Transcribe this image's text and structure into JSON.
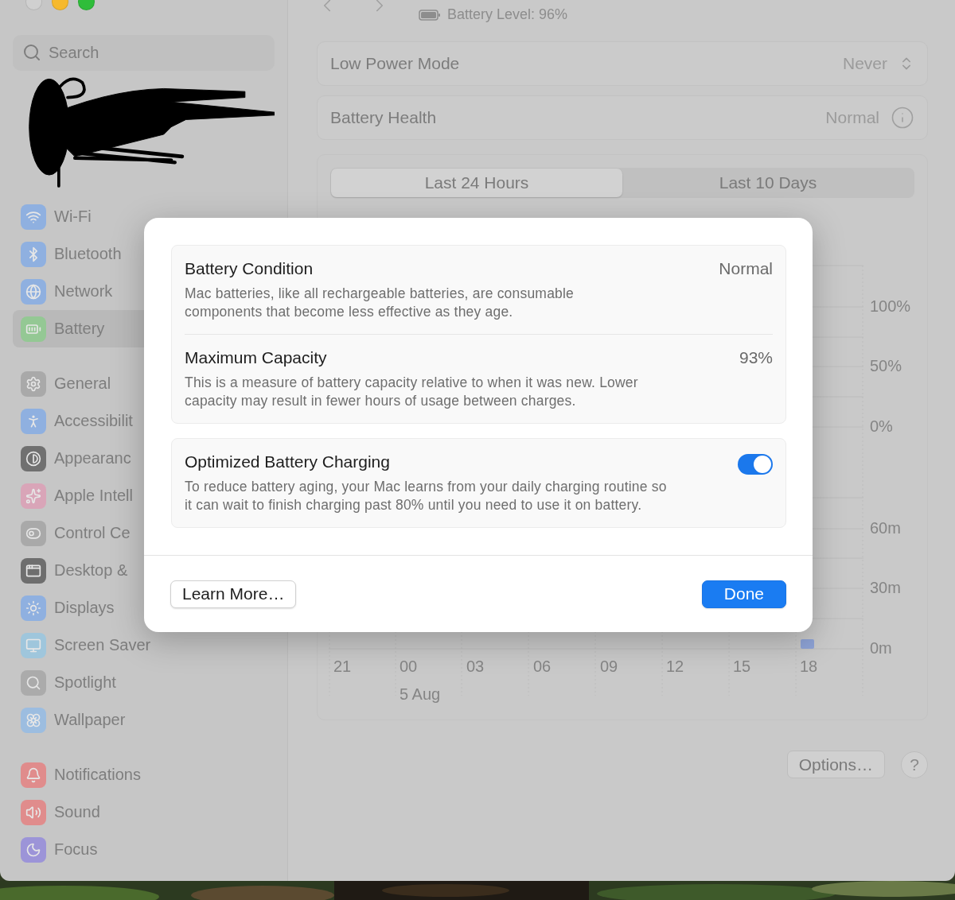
{
  "sidebar": {
    "search": {
      "placeholder": "Search"
    },
    "groups": [
      {
        "items": [
          {
            "label": "Wi-Fi",
            "selected": false,
            "color": "#8fb0e0"
          },
          {
            "label": "Bluetooth",
            "selected": false,
            "color": "#8fb0e0"
          },
          {
            "label": "Network",
            "selected": false,
            "color": "#8fb0e0"
          },
          {
            "label": "Battery",
            "selected": true,
            "color": "#94c894"
          }
        ]
      },
      {
        "items": [
          {
            "label": "General",
            "selected": false,
            "color": "#a9a9a9"
          },
          {
            "label": "Accessibilit",
            "selected": false,
            "color": "#8fb0e0"
          },
          {
            "label": "Appearanc",
            "selected": false,
            "color": "#707070"
          },
          {
            "label": "Apple Intell",
            "selected": false,
            "color": "#d9a5b8"
          },
          {
            "label": "Control Ce",
            "selected": false,
            "color": "#a9a9a9"
          },
          {
            "label": "Desktop &",
            "selected": false,
            "color": "#6e6e6e"
          },
          {
            "label": "Displays",
            "selected": false,
            "color": "#8fb0e0"
          },
          {
            "label": "Screen Saver",
            "selected": false,
            "color": "#9fc6dc"
          },
          {
            "label": "Spotlight",
            "selected": false,
            "color": "#ababab"
          },
          {
            "label": "Wallpaper",
            "selected": false,
            "color": "#9cbde0"
          }
        ]
      },
      {
        "items": [
          {
            "label": "Notifications",
            "selected": false,
            "color": "#e08c8c"
          },
          {
            "label": "Sound",
            "selected": false,
            "color": "#e08c8c"
          },
          {
            "label": "Focus",
            "selected": false,
            "color": "#9c94d8"
          }
        ]
      }
    ]
  },
  "header": {
    "subtitle": "Battery Level: 96%"
  },
  "settings_rows": [
    {
      "kind": "popup",
      "label": "Low Power Mode",
      "value": "Never"
    },
    {
      "kind": "info",
      "label": "Battery Health",
      "value": "Normal"
    }
  ],
  "usage": {
    "tabs": [
      {
        "label": "Last 24 Hours",
        "selected": true
      },
      {
        "label": "Last 10 Days",
        "selected": false
      }
    ],
    "level_ticks": [
      "100%",
      "50%",
      "0%"
    ],
    "time_ticks": [
      "60m",
      "30m",
      "0m"
    ],
    "hours": [
      "21",
      "00",
      "03",
      "06",
      "09",
      "12",
      "15",
      "18"
    ],
    "date": "5 Aug"
  },
  "footer": {
    "options_button": "Options…",
    "help_button": "?"
  },
  "dialog": {
    "groups": [
      {
        "rows": [
          {
            "kind": "value",
            "title": "Battery Condition",
            "value": "Normal",
            "description": "Mac batteries, like all rechargeable batteries, are consumable\ncomponents that become less effective as they age."
          },
          {
            "kind": "value",
            "title": "Maximum Capacity",
            "value": "93%",
            "description": "This is a measure of battery capacity relative to when it was new. Lower\ncapacity may result in fewer hours of usage between charges."
          }
        ]
      },
      {
        "rows": [
          {
            "kind": "toggle",
            "title": "Optimized Battery Charging",
            "on": true,
            "description": "To reduce battery aging, your Mac learns from your daily charging routine so\nit can wait to finish charging past 80% until you need to use it on battery."
          }
        ]
      }
    ],
    "buttons": [
      {
        "kind": "secondary",
        "label": "Learn More…"
      },
      {
        "kind": "primary",
        "label": "Done"
      }
    ]
  }
}
